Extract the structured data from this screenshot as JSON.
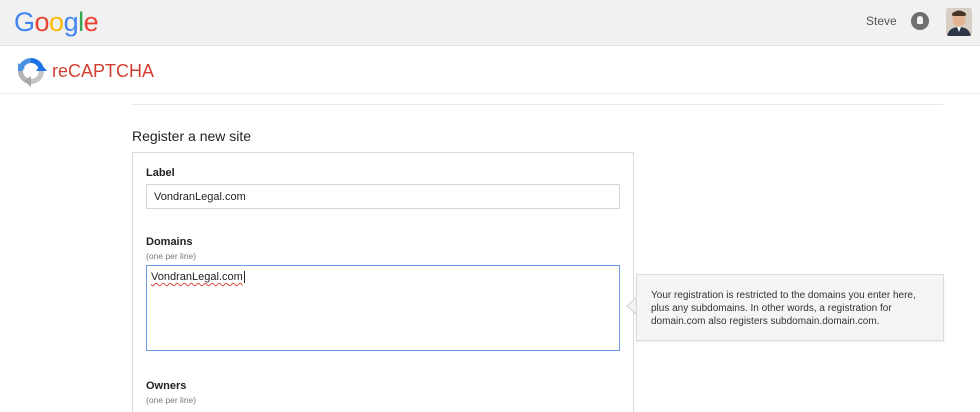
{
  "header": {
    "logo_letters": [
      "G",
      "o",
      "o",
      "g",
      "l",
      "e"
    ],
    "logo_colors": [
      "#4285f4",
      "#ea4335",
      "#fbbc05",
      "#4285f4",
      "#34a853",
      "#ea4335"
    ],
    "user_name": "Steve",
    "notifications_icon": "bell-icon",
    "avatar_icon": "user-avatar"
  },
  "product": {
    "name": "reCAPTCHA",
    "logo_icon": "recaptcha-logo",
    "accent_color": "#d23f31"
  },
  "form": {
    "title": "Register a new site",
    "label": {
      "label": "Label",
      "value": "VondranLegal.com"
    },
    "domains": {
      "label": "Domains",
      "hint": "(one per line)",
      "value": "VondranLegal.com"
    },
    "owners": {
      "label": "Owners",
      "hint": "(one per line)"
    }
  },
  "tooltip": {
    "text": "Your registration is restricted to the domains you enter here, plus any subdomains. In other words, a registration for domain.com also registers subdomain.domain.com."
  }
}
